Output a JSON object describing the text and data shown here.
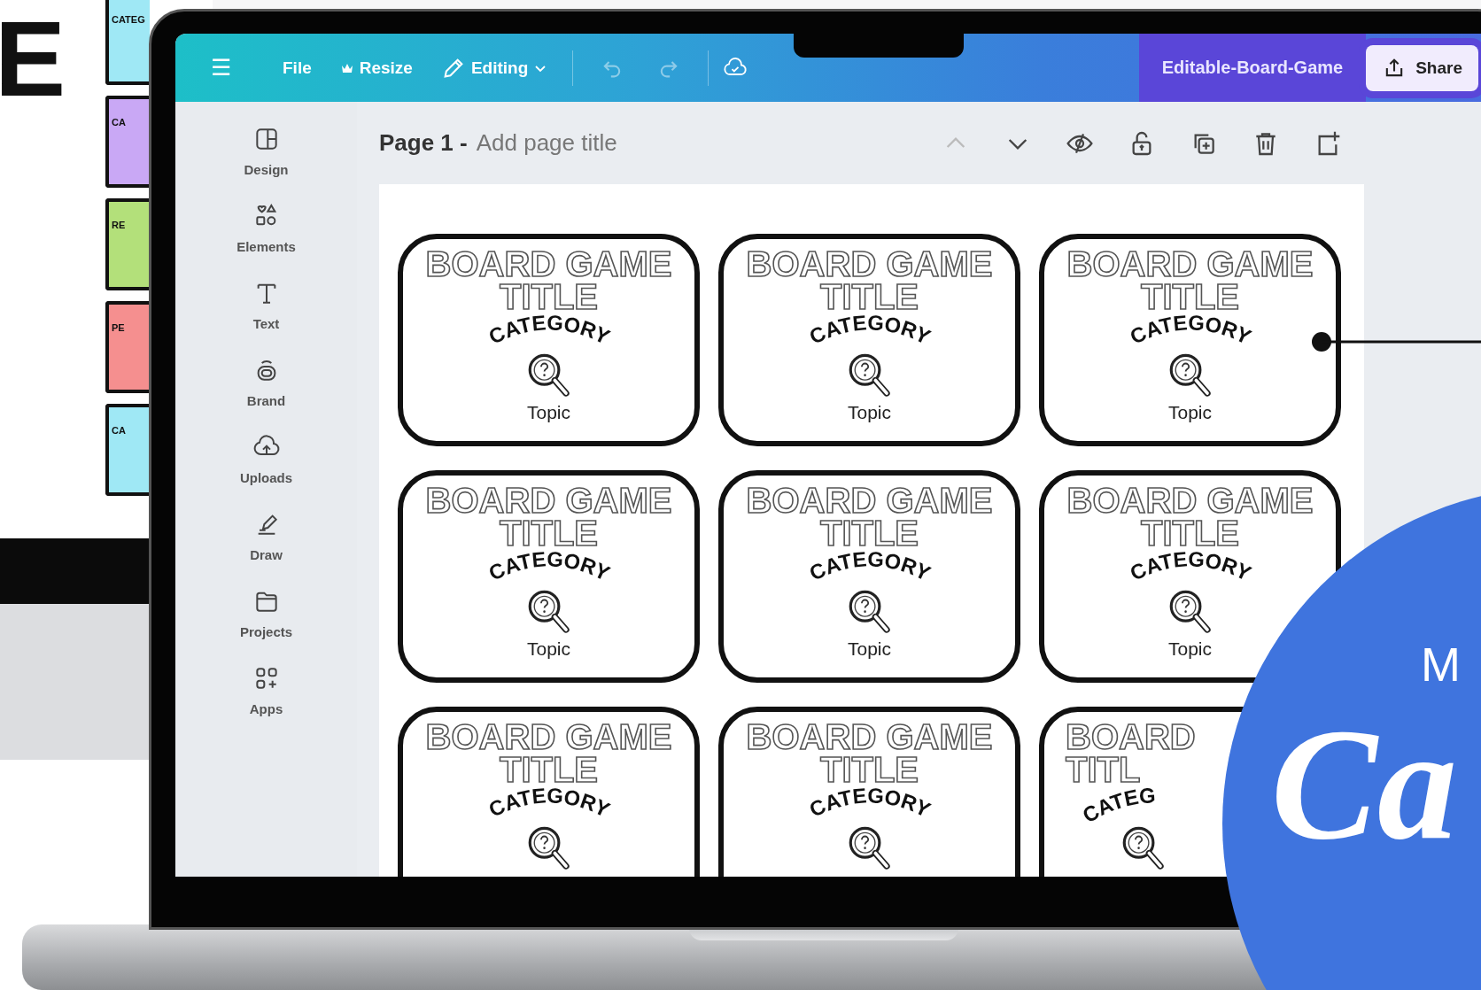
{
  "backdrop": {
    "letter": "E",
    "tiles": [
      {
        "label": "CATEG",
        "color": "#9fe8f5"
      },
      {
        "label": "CA",
        "color": "#c9a8f5"
      },
      {
        "label": "RE",
        "color": "#b3e07a"
      },
      {
        "label": "PE",
        "color": "#f58f8f"
      },
      {
        "label": "CA",
        "color": "#9fe8f5"
      }
    ]
  },
  "toolbar": {
    "menu": "☰",
    "file": "File",
    "resize": "Resize",
    "editing": "Editing",
    "title": "Editable-Board-Game",
    "share": "Share"
  },
  "sidebar": {
    "items": [
      {
        "kind": "design",
        "label": "Design"
      },
      {
        "kind": "elements",
        "label": "Elements"
      },
      {
        "kind": "text",
        "label": "Text"
      },
      {
        "kind": "brand",
        "label": "Brand"
      },
      {
        "kind": "uploads",
        "label": "Uploads"
      },
      {
        "kind": "draw",
        "label": "Draw"
      },
      {
        "kind": "projects",
        "label": "Projects"
      },
      {
        "kind": "apps",
        "label": "Apps"
      }
    ]
  },
  "page_header": {
    "label": "Page 1 -",
    "placeholder": "Add page title",
    "nav": [
      {
        "kind": "up",
        "disabled": true
      },
      {
        "kind": "down",
        "disabled": false
      }
    ],
    "actions": [
      {
        "kind": "hide"
      },
      {
        "kind": "lock"
      },
      {
        "kind": "duplicate"
      },
      {
        "kind": "delete"
      },
      {
        "kind": "add"
      }
    ]
  },
  "cards": [
    {
      "kind": "full",
      "line1": "BOARD GAME",
      "line2": "TITLE",
      "category": "CATEGORY",
      "topic": "Topic"
    },
    {
      "kind": "full",
      "line1": "BOARD GAME",
      "line2": "TITLE",
      "category": "CATEGORY",
      "topic": "Topic"
    },
    {
      "kind": "full",
      "line1": "BOARD GAME",
      "line2": "TITLE",
      "category": "CATEGORY",
      "topic": "Topic"
    },
    {
      "kind": "full",
      "line1": "BOARD GAME",
      "line2": "TITLE",
      "category": "CATEGORY",
      "topic": "Topic"
    },
    {
      "kind": "full",
      "line1": "BOARD GAME",
      "line2": "TITLE",
      "category": "CATEGORY",
      "topic": "Topic"
    },
    {
      "kind": "full",
      "line1": "BOARD GAME",
      "line2": "TITLE",
      "category": "CATEGORY",
      "topic": "Topic"
    },
    {
      "kind": "full",
      "line1": "BOARD GAME",
      "line2": "TITLE",
      "category": "CATEGORY"
    },
    {
      "kind": "full",
      "line1": "BOARD GAME",
      "line2": "TITLE",
      "category": "CATEGORY"
    },
    {
      "kind": "covered",
      "line1": "BOARD",
      "line2": "TITL",
      "category": "CATEG"
    }
  ],
  "badge": {
    "small": "M",
    "script": "Ca"
  }
}
